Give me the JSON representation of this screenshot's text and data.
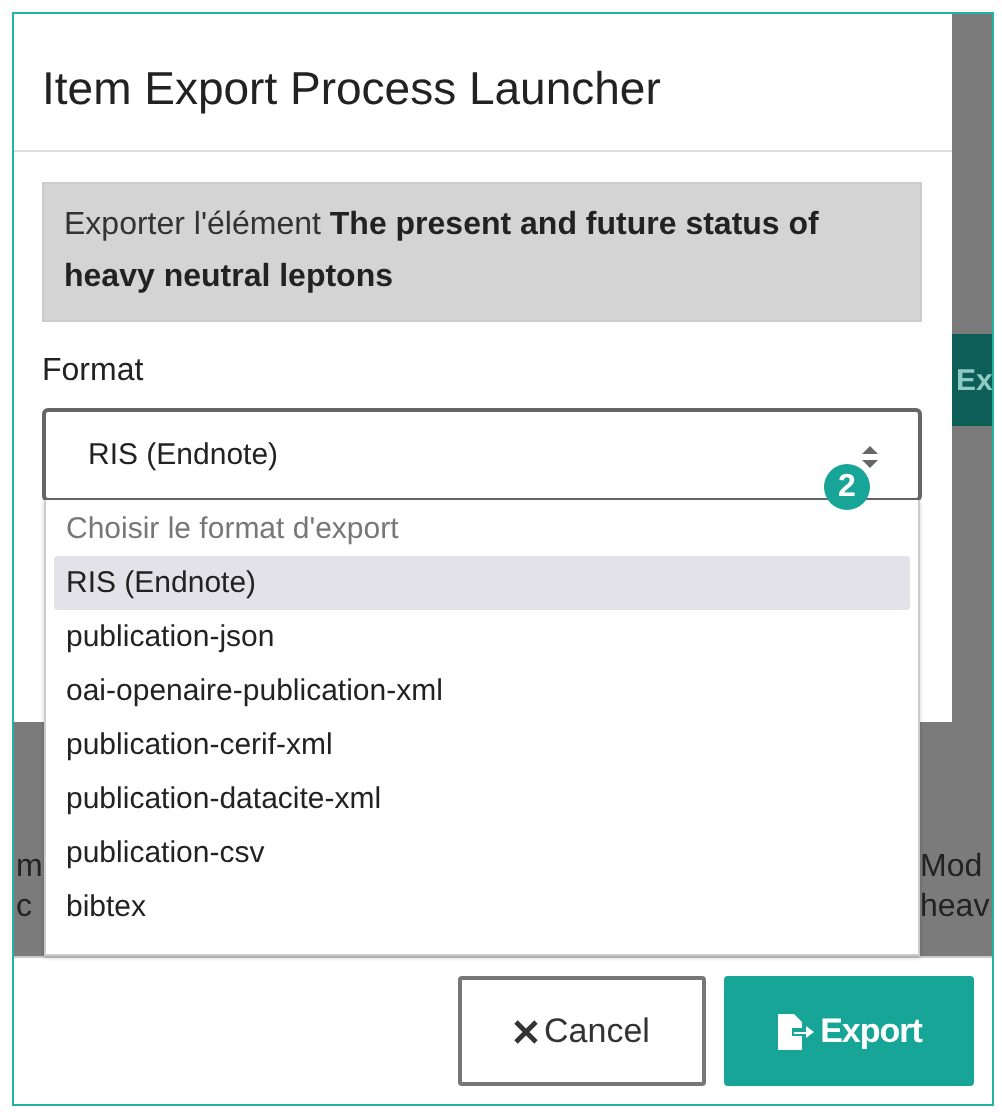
{
  "dialog": {
    "title": "Item Export Process Launcher",
    "info": "Exporter l'élément **The present and future status of heavy neutral leptons**",
    "format_label": "Format",
    "select": {
      "value": "RIS (Endnote)",
      "expanded": true,
      "badge": "2",
      "options": [
        {
          "label": "Choisir le format d'export",
          "kind": "placeholder",
          "selected": false
        },
        {
          "label": "RIS (Endnote)",
          "kind": "option",
          "selected": true
        },
        {
          "label": "publication-json",
          "kind": "option",
          "selected": false
        },
        {
          "label": "oai-openaire-publication-xml",
          "kind": "option",
          "selected": false
        },
        {
          "label": "publication-cerif-xml",
          "kind": "option",
          "selected": false
        },
        {
          "label": "publication-datacite-xml",
          "kind": "option",
          "selected": false
        },
        {
          "label": "publication-csv",
          "kind": "option",
          "selected": false
        },
        {
          "label": "bibtex",
          "kind": "option",
          "selected": false
        }
      ]
    },
    "buttons": [
      {
        "label": "Cancel",
        "kind": "cancel"
      },
      {
        "label": "Export",
        "kind": "primary"
      }
    ]
  },
  "background": {
    "button": "Ex",
    "left_texts": [
      "m",
      "c"
    ],
    "right_texts": [
      "Mod",
      "heav"
    ]
  }
}
